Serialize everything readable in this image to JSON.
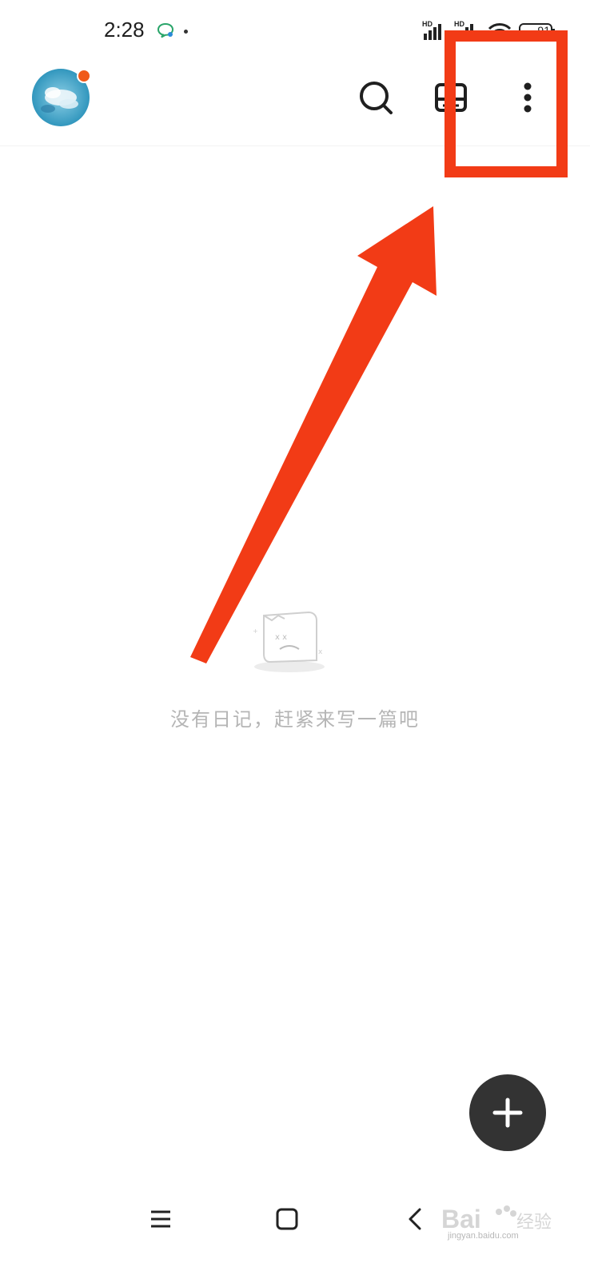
{
  "status_bar": {
    "time": "2:28",
    "chat_icon": "chat-bubble-icon",
    "hd_label": "HD",
    "battery": "91"
  },
  "header": {
    "avatar": "avatar",
    "icons": {
      "search": "search-icon",
      "calendar": "calendar-icon",
      "more": "more-vertical-icon"
    }
  },
  "empty_state": {
    "icon": "empty-diary-icon",
    "message": "没有日记，赶紧来写一篇吧"
  },
  "fab": {
    "icon": "plus-icon"
  },
  "nav_bar": {
    "menu_icon": "menu-icon",
    "home_icon": "home-square-icon",
    "back_icon": "back-chevron-icon"
  },
  "watermark": {
    "brand": "Bai",
    "brand_cn": "经验",
    "url": "jingyan.baidu.com"
  },
  "colors": {
    "annotation": "#f23b16",
    "fab": "#333333",
    "empty_text": "#b5b5b5",
    "badge": "#f05a1a"
  }
}
